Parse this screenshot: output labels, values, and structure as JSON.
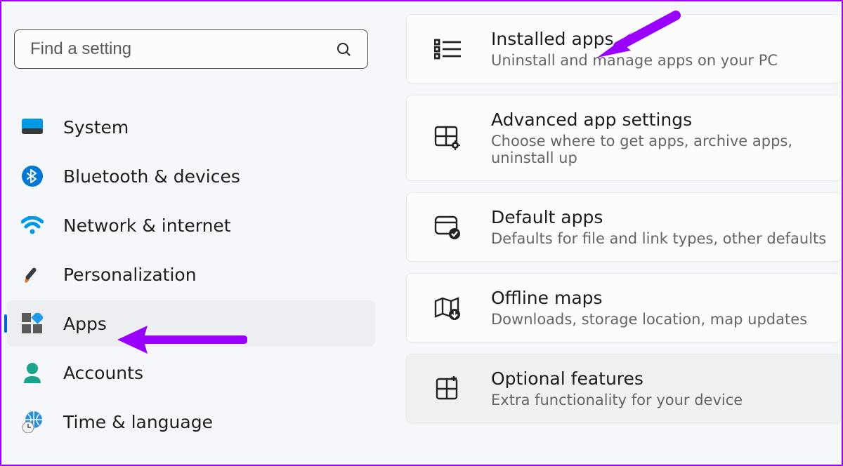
{
  "search": {
    "placeholder": "Find a setting"
  },
  "sidebar": {
    "items": [
      {
        "label": "System"
      },
      {
        "label": "Bluetooth & devices"
      },
      {
        "label": "Network & internet"
      },
      {
        "label": "Personalization"
      },
      {
        "label": "Apps"
      },
      {
        "label": "Accounts"
      },
      {
        "label": "Time & language"
      }
    ]
  },
  "cards": [
    {
      "title": "Installed apps",
      "sub": "Uninstall and manage apps on your PC"
    },
    {
      "title": "Advanced app settings",
      "sub": "Choose where to get apps, archive apps, uninstall up"
    },
    {
      "title": "Default apps",
      "sub": "Defaults for file and link types, other defaults"
    },
    {
      "title": "Offline maps",
      "sub": "Downloads, storage location, map updates"
    },
    {
      "title": "Optional features",
      "sub": "Extra functionality for your device"
    }
  ]
}
